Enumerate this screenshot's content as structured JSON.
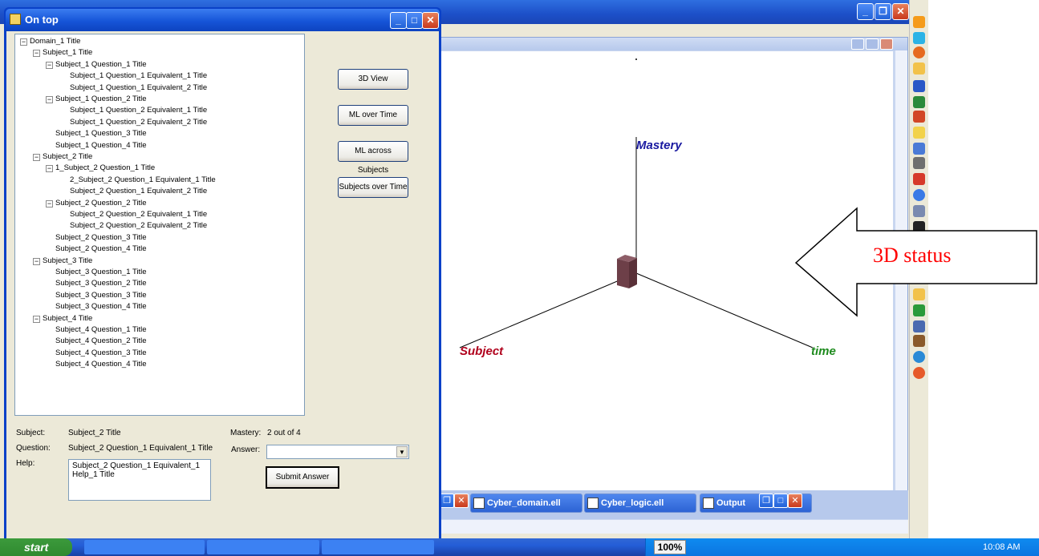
{
  "dialog": {
    "title": "On top",
    "tree": [
      {
        "label": "Domain_1 Title",
        "level": 0,
        "expander": "−"
      },
      {
        "label": "Subject_1 Title",
        "level": 1,
        "expander": "−"
      },
      {
        "label": "Subject_1 Question_1 Title",
        "level": 2,
        "expander": "−"
      },
      {
        "label": "Subject_1 Question_1 Equivalent_1 Title",
        "level": 3,
        "expander": ""
      },
      {
        "label": "Subject_1 Question_1 Equivalent_2 Title",
        "level": 3,
        "expander": ""
      },
      {
        "label": "Subject_1 Question_2 Title",
        "level": 2,
        "expander": "−"
      },
      {
        "label": "Subject_1 Question_2 Equivalent_1 Title",
        "level": 3,
        "expander": ""
      },
      {
        "label": "Subject_1 Question_2 Equivalent_2 Title",
        "level": 3,
        "expander": ""
      },
      {
        "label": "Subject_1 Question_3 Title",
        "level": 2,
        "expander": ""
      },
      {
        "label": "Subject_1 Question_4 Title",
        "level": 2,
        "expander": ""
      },
      {
        "label": "Subject_2 Title",
        "level": 1,
        "expander": "−"
      },
      {
        "label": "1_Subject_2 Question_1 Title",
        "level": 2,
        "expander": "−"
      },
      {
        "label": "2_Subject_2 Question_1 Equivalent_1 Title",
        "level": 3,
        "expander": ""
      },
      {
        "label": "Subject_2 Question_1 Equivalent_2 Title",
        "level": 3,
        "expander": ""
      },
      {
        "label": "Subject_2 Question_2 Title",
        "level": 2,
        "expander": "−"
      },
      {
        "label": "Subject_2 Question_2 Equivalent_1 Title",
        "level": 3,
        "expander": ""
      },
      {
        "label": "Subject_2 Question_2 Equivalent_2 Title",
        "level": 3,
        "expander": ""
      },
      {
        "label": "Subject_2 Question_3 Title",
        "level": 2,
        "expander": ""
      },
      {
        "label": "Subject_2 Question_4 Title",
        "level": 2,
        "expander": ""
      },
      {
        "label": "Subject_3 Title",
        "level": 1,
        "expander": "−"
      },
      {
        "label": "Subject_3 Question_1 Title",
        "level": 2,
        "expander": ""
      },
      {
        "label": "Subject_3 Question_2 Title",
        "level": 2,
        "expander": ""
      },
      {
        "label": "Subject_3 Question_3 Title",
        "level": 2,
        "expander": ""
      },
      {
        "label": "Subject_3 Question_4 Title",
        "level": 2,
        "expander": ""
      },
      {
        "label": "Subject_4 Title",
        "level": 1,
        "expander": "−"
      },
      {
        "label": "Subject_4 Question_1 Title",
        "level": 2,
        "expander": ""
      },
      {
        "label": "Subject_4 Question_2 Title",
        "level": 2,
        "expander": ""
      },
      {
        "label": "Subject_4 Question_3 Title",
        "level": 2,
        "expander": ""
      },
      {
        "label": "Subject_4 Question_4 Title",
        "level": 2,
        "expander": ""
      }
    ],
    "buttons": {
      "view_3d": "3D View",
      "ml_over_time": "ML over Time",
      "ml_across_subjects": "ML across Subjects",
      "subjects_over_time": "Subjects over Time",
      "submit": "Submit Answer"
    },
    "info": {
      "subject_label": "Subject:",
      "subject_value": "Subject_2 Title",
      "question_label": "Question:",
      "question_value": "Subject_2 Question_1 Equivalent_1 Title",
      "help_label": "Help:",
      "help_value": "Subject_2 Question_1 Equivalent_1 Help_1 Title",
      "mastery_label": "Mastery:",
      "mastery_value": "2 out of 4",
      "answer_label": "Answer:",
      "answer_value": ""
    }
  },
  "view3d": {
    "axis_mastery": "Mastery",
    "axis_subject": "Subject",
    "axis_time": "time",
    "mastery_color": "#1a1aa0",
    "subject_color": "#b0001c",
    "time_color": "#1d8a1d",
    "block_color": "#7a4b55"
  },
  "callout": {
    "text": "3D status",
    "color": "#ff0000"
  },
  "inner_tabs": [
    {
      "label": "Cyber_domain.ell"
    },
    {
      "label": "Cyber_logic.ell"
    },
    {
      "label": "Output"
    }
  ],
  "taskbar": {
    "start": "start",
    "tasks": [
      "",
      "",
      "",
      ""
    ],
    "zoom": "100%",
    "clock": "10:08 AM"
  },
  "icons": [
    "app-icon",
    "minimize-icon",
    "maximize-icon",
    "close-icon",
    "expand-icon",
    "collapse-icon",
    "dropdown-arrow-icon",
    "document-icon"
  ]
}
